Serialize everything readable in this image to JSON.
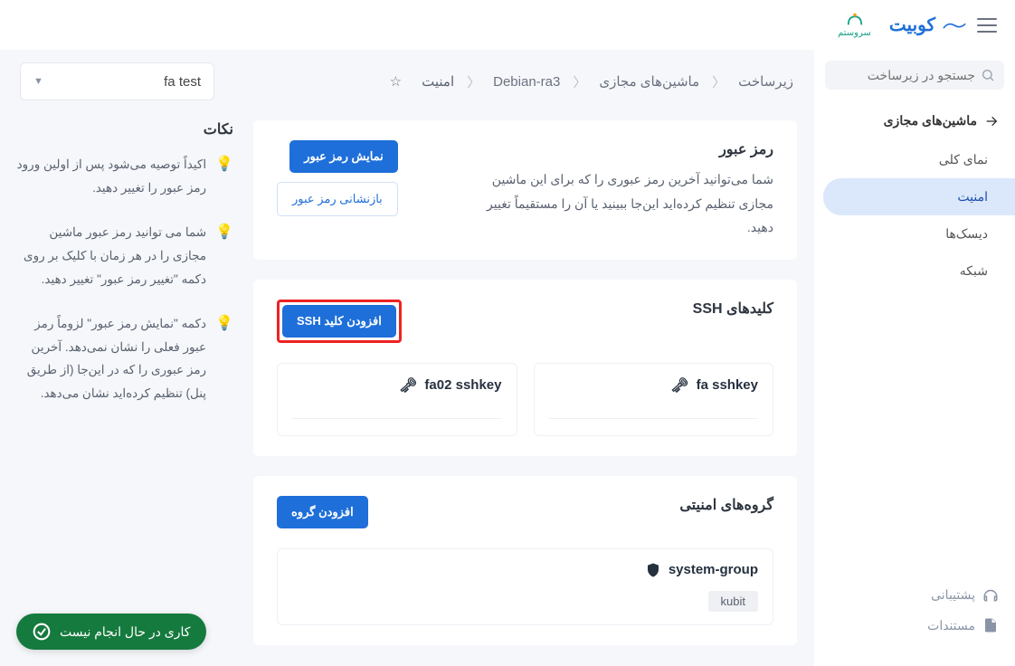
{
  "brand": {
    "name": "کوبیت",
    "partner": "سروستم"
  },
  "sidebar": {
    "search_placeholder": "جستجو در زیرساخت",
    "header": "ماشین‌های مجازی",
    "items": [
      {
        "label": "نمای کلی"
      },
      {
        "label": "امنیت"
      },
      {
        "label": "دیسک‌ها"
      },
      {
        "label": "شبکه"
      }
    ],
    "bottom": [
      {
        "label": "پشتیبانی"
      },
      {
        "label": "مستندات"
      }
    ]
  },
  "breadcrumb": {
    "root": "زیرساخت",
    "mid": "ماشین‌های مجازی",
    "vm": "Debian-ra3",
    "current": "امنیت"
  },
  "project_selector": {
    "value": "fa test"
  },
  "password_card": {
    "title": "رمز عبور",
    "desc": "شما می‌توانید آخرین رمز عبوری را که برای این ماشین مجازی تنظیم کرده‌اید این‌جا ببینید یا آن را مستقیماً تغییر دهید.",
    "btn_show": "نمایش رمز عبور",
    "btn_reset": "بازنشانی رمز عبور"
  },
  "ssh_card": {
    "title": "کلیدهای SSH",
    "btn_add": "افزودن کلید SSH",
    "keys": [
      {
        "name": "fa sshkey"
      },
      {
        "name": "fa02 sshkey"
      }
    ]
  },
  "groups_card": {
    "title": "گروه‌های امنیتی",
    "btn_add": "افزودن گروه",
    "groups": [
      {
        "name": "system-group",
        "tag": "kubit"
      }
    ]
  },
  "tips": {
    "title": "نکات",
    "items": [
      "اکیداً توصیه می‌شود پس از اولین ورود رمز عبور را تغییر دهید.",
      "شما می توانید رمز عبور ماشین مجازی را در هر زمان با کلیک بر روی دکمه \"تغییر رمز عبور\" تغییر دهید.",
      "دکمه \"نمایش رمز عبور\" لزوماً رمز عبور فعلی را نشان نمی‌دهد. آخرین رمز عبوری را که در این‌جا (از طریق پنل) تنظیم کرده‌اید نشان می‌دهد."
    ]
  },
  "status": {
    "text": "کاری در حال انجام نیست"
  }
}
